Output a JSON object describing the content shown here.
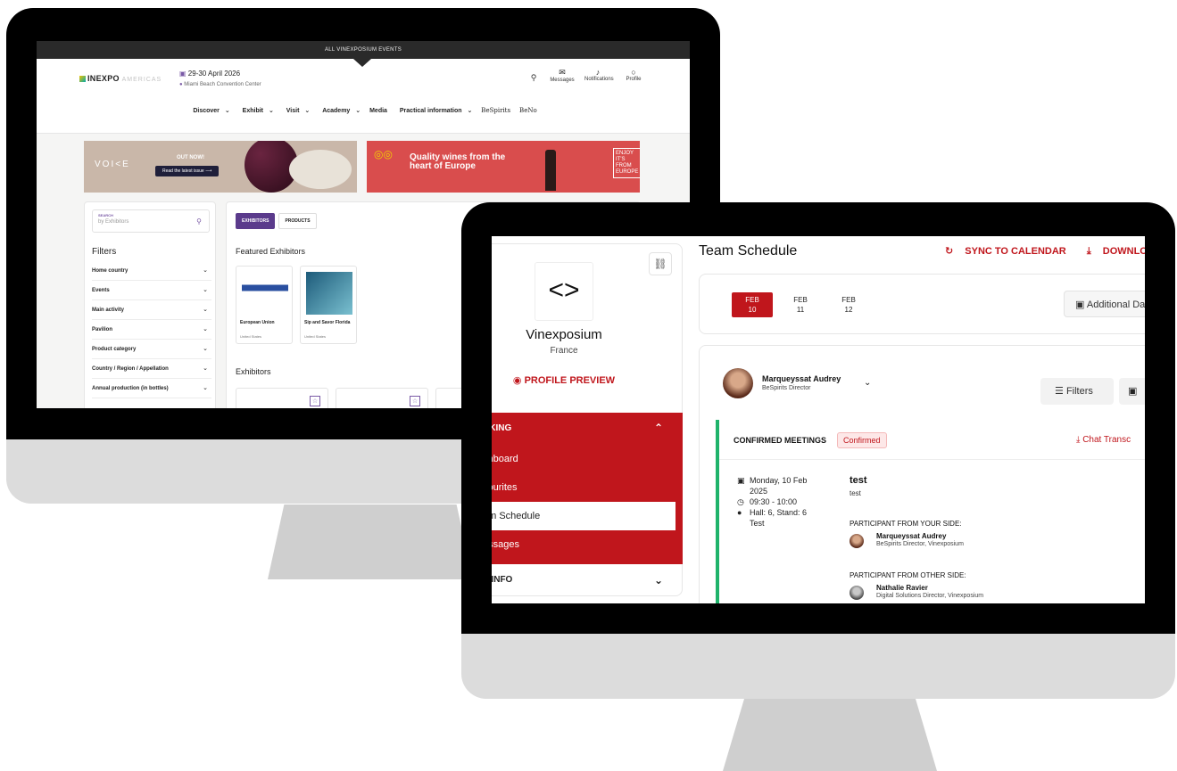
{
  "back_screen": {
    "topbar": "ALL VINEXPOSIUM EVENTS",
    "logo": {
      "main": "INEXPO",
      "sub": "AMERICAS"
    },
    "event": {
      "date": "29-30 April 2026",
      "venue": "Miami Beach Convention Center"
    },
    "header_icons": [
      {
        "name": "search",
        "label": ""
      },
      {
        "name": "messages",
        "label": "Messages"
      },
      {
        "name": "notifications",
        "label": "Notifications"
      },
      {
        "name": "profile",
        "label": "Profile"
      }
    ],
    "nav": [
      "Discover",
      "Exhibit",
      "Visit",
      "Academy",
      "Media",
      "Practical information",
      "BeSpirits",
      "BeNo"
    ],
    "banner_left": {
      "brand": "VOI<E",
      "out_now": "OUT NOW!",
      "cta": "Read the latest issue"
    },
    "banner_right": {
      "title_line1": "Quality wines from the",
      "title_line2": "heart of Europe",
      "side": "ENJOY IT'S FROM EUROPE"
    },
    "search": {
      "label": "SEARCH",
      "placeholder": "by Exhibitors"
    },
    "filters_title": "Filters",
    "filters": [
      "Home country",
      "Events",
      "Main activity",
      "Pavilion",
      "Product category",
      "Country / Region / Appellation",
      "Annual production (in bottles)"
    ],
    "tabs": [
      "EXHIBITORS",
      "PRODUCTS"
    ],
    "featured_title": "Featured Exhibitors",
    "featured": [
      {
        "name": "European Union",
        "country": "United States"
      },
      {
        "name": "Sip and Savor Florida",
        "country": "United States"
      }
    ],
    "exhibitors_title": "Exhibitors"
  },
  "front_screen": {
    "company": "Vinexposium",
    "country": "France",
    "profile_preview": "PROFILE PREVIEW",
    "menu_header": "RKING",
    "menu_items": [
      "shboard",
      "vourites",
      "am Schedule",
      "essages"
    ],
    "info_header": "E INFO",
    "title": "Team Schedule",
    "sync": "SYNC TO CALENDAR",
    "download": "DOWNLOAD S",
    "dates": [
      {
        "month": "FEB",
        "day": "10"
      },
      {
        "month": "FEB",
        "day": "11"
      },
      {
        "month": "FEB",
        "day": "12"
      }
    ],
    "additional": "Additional Da",
    "person": {
      "name": "Marqueyssat Audrey",
      "role": "BeSpirits Director"
    },
    "filters_btn": "Filters",
    "confirmed_label": "CONFIRMED MEETINGS",
    "confirmed_badge": "Confirmed",
    "chat": "Chat Transc",
    "meeting": {
      "date_line1": "Monday, 10 Feb",
      "date_line2": "2025",
      "time": "09:30 - 10:00",
      "location_line1": "Hall: 6, Stand: 6",
      "location_line2": "Test",
      "title": "test",
      "desc": "test",
      "your_side_label": "PARTICIPANT FROM YOUR SIDE:",
      "your_side": {
        "name": "Marqueyssat Audrey",
        "role": "BeSpirits Director, Vinexposium"
      },
      "other_side_label": "PARTICIPANT FROM OTHER SIDE:",
      "other_side": {
        "name": "Nathalie Ravier",
        "role": "Digital Solutions Director, Vinexposium"
      }
    }
  },
  "colors": {
    "brand_red": "#c0161c",
    "accent_purple": "#5b3b8c",
    "confirmed_green": "#1fb36b"
  }
}
